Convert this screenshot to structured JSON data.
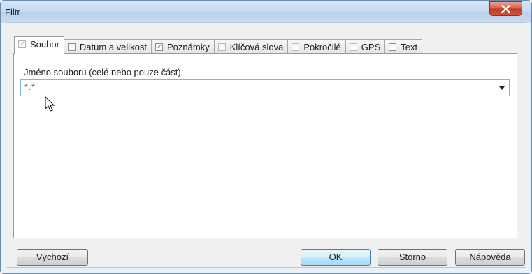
{
  "window": {
    "title": "Filtr"
  },
  "tabs": [
    {
      "label": "Soubor",
      "checked": true,
      "active": true,
      "dim": true
    },
    {
      "label": "Datum a velikost",
      "checked": false,
      "active": false,
      "dim": false
    },
    {
      "label": "Poznámky",
      "checked": true,
      "active": false,
      "dim": false
    },
    {
      "label": "Klíčová slova",
      "checked": false,
      "active": false,
      "dim": true
    },
    {
      "label": "Pokročilé",
      "checked": false,
      "active": false,
      "dim": true
    },
    {
      "label": "GPS",
      "checked": false,
      "active": false,
      "dim": true
    },
    {
      "label": "Text",
      "checked": false,
      "active": false,
      "dim": false
    }
  ],
  "filename": {
    "label": "Jméno souboru (celé nebo pouze část):",
    "value": "*.*"
  },
  "buttons": {
    "default_label": "Výchozí",
    "ok_label": "OK",
    "cancel_label": "Storno",
    "help_label": "Nápověda"
  },
  "colors": {
    "accent": "#7eb4ea",
    "close_button": "#c13c27",
    "titlebar": "#c6daf0"
  },
  "icons": [
    "close-icon",
    "checkbox-icon",
    "dropdown-arrow-icon",
    "mouse-pointer-icon"
  ]
}
